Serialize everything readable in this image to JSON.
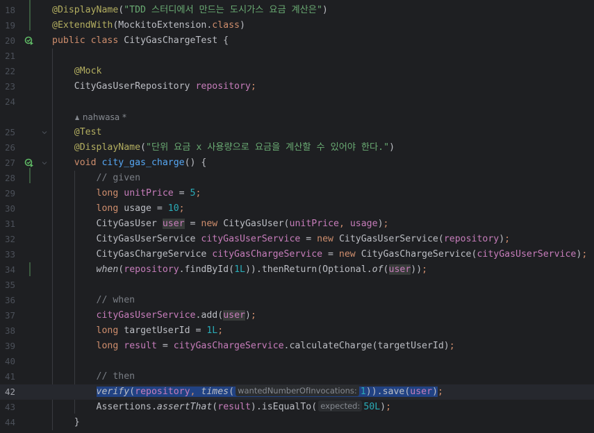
{
  "editor": {
    "colors": {
      "background": "#1e1f22",
      "annotation": "#b3ae60",
      "string": "#6aab73",
      "keyword": "#cf8e6d",
      "field": "#c77dbb",
      "number": "#2aacb8",
      "comment": "#7a7e85",
      "method": "#56a8f5",
      "selection": "#214283"
    },
    "gutter_icons": {
      "run_test": "run-test-icon",
      "fold": "fold-arrow-icon"
    },
    "author_hint": {
      "icon": "person-icon",
      "text": "nahwasa *"
    },
    "line_numbers": [
      "18",
      "19",
      "20",
      "21",
      "22",
      "23",
      "24",
      "25",
      "26",
      "27",
      "28",
      "29",
      "30",
      "31",
      "32",
      "33",
      "34",
      "35",
      "36",
      "37",
      "38",
      "39",
      "40",
      "41",
      "42",
      "43",
      "44"
    ],
    "tokens": {
      "l18_ann": "@DisplayName",
      "l18_str": "\"TDD 스터디에서 만드는 도시가스 요금 계산은\"",
      "l19_ann": "@ExtendWith",
      "l19_cls": "MockitoExtension",
      "l19_kw": "class",
      "l20_kw1": "public",
      "l20_kw2": "class",
      "l20_name": "CityGasChargeTest",
      "l22_ann": "@Mock",
      "l23_type": "CityGasUserRepository",
      "l23_field": "repository",
      "l25_ann": "@Test",
      "l26_ann": "@DisplayName",
      "l26_str": "\"단위 요금 x 사용량으로 요금을 계산할 수 있어야 한다.\"",
      "l27_kw": "void",
      "l27_name": "city_gas_charge",
      "l28_cmt": "// given",
      "l29_kw": "long",
      "l29_var": "unitPrice",
      "l29_num": "5",
      "l30_kw": "long",
      "l30_var": "usage",
      "l30_num": "10",
      "l31_type": "CityGasUser",
      "l31_var": "user",
      "l31_kw": "new",
      "l31_cls": "CityGasUser",
      "l31_a1": "unitPrice",
      "l31_a2": "usage",
      "l32_type": "CityGasUserService",
      "l32_var": "cityGasUserService",
      "l32_kw": "new",
      "l32_cls": "CityGasUserService",
      "l32_a1": "repository",
      "l33_type": "CityGasChargeService",
      "l33_var": "cityGasChargeService",
      "l33_kw": "new",
      "l33_cls": "CityGasChargeService",
      "l33_a1": "cityGasUserService",
      "l34_when": "when",
      "l34_repo": "repository",
      "l34_find": "findById",
      "l34_num": "1L",
      "l34_then": "thenReturn",
      "l34_opt": "Optional",
      "l34_of": "of",
      "l34_user": "user",
      "l36_cmt": "// when",
      "l37_var": "cityGasUserService",
      "l37_add": "add",
      "l37_user": "user",
      "l38_kw": "long",
      "l38_var": "targetUserId",
      "l38_num": "1L",
      "l39_kw": "long",
      "l39_var": "result",
      "l39_svc": "cityGasChargeService",
      "l39_call": "calculateCharge",
      "l39_arg": "targetUserId",
      "l41_cmt": "// then",
      "l42_verify": "verify",
      "l42_repo": "repository",
      "l42_times": "times",
      "l42_hint": "wantedNumberOfInvocations:",
      "l42_num": "1",
      "l42_save": "save",
      "l42_user": "user",
      "l43_cls": "Assertions",
      "l43_assert": "assertThat",
      "l43_res": "result",
      "l43_eq": "isEqualTo",
      "l43_hint": "expected:",
      "l43_num": "50L",
      "l44_brace": "}"
    }
  }
}
